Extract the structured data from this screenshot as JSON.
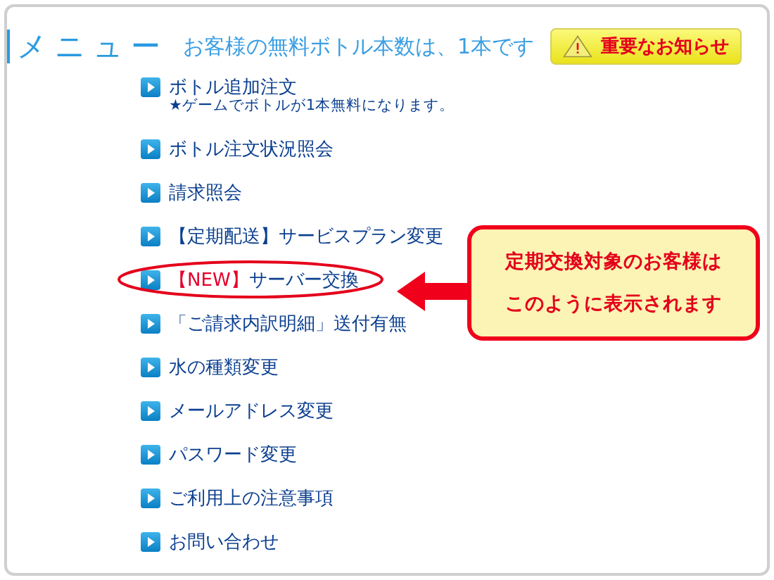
{
  "header": {
    "title": "メニュー",
    "free_bottles": "お客様の無料ボトル本数は、1本です",
    "notice_button": "重要なお知らせ"
  },
  "menu": [
    {
      "label": "ボトル追加注文",
      "note": "★ゲームでボトルが1本無料になります。",
      "highlighted": false
    },
    {
      "label": "ボトル注文状況照会",
      "highlighted": false
    },
    {
      "label": "請求照会",
      "highlighted": false
    },
    {
      "label": "【定期配送】サービスプラン変更",
      "highlighted": false
    },
    {
      "tag": "【NEW】",
      "label": "サーバー交換",
      "highlighted": true
    },
    {
      "label": "「ご請求内訳明細」送付有無",
      "highlighted": false
    },
    {
      "label": "水の種類変更",
      "highlighted": false
    },
    {
      "label": "メールアドレス変更",
      "highlighted": false
    },
    {
      "label": "パスワード変更",
      "highlighted": false
    },
    {
      "label": "ご利用上の注意事項",
      "highlighted": false
    },
    {
      "label": "お問い合わせ",
      "highlighted": false
    }
  ],
  "callout": {
    "lines": [
      "定期交換対象のお客様は",
      "このように表示されます"
    ]
  }
}
